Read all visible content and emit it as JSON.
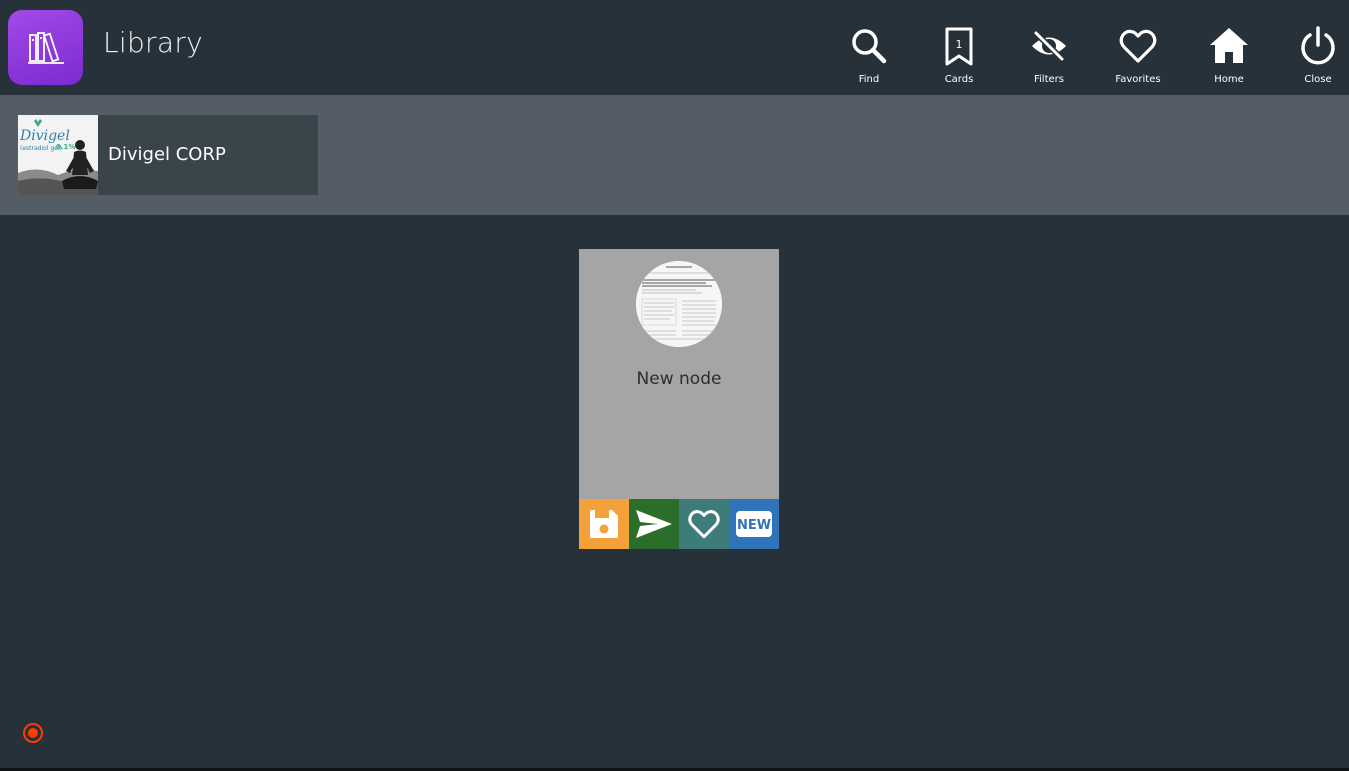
{
  "app": {
    "title": "Library",
    "logo_icon": "books-icon"
  },
  "toolbar": {
    "items": [
      {
        "label": "Find",
        "icon": "search-icon"
      },
      {
        "label": "Cards",
        "icon": "bookmark-icon",
        "badge": "1"
      },
      {
        "label": "Filters",
        "icon": "eye-off-icon"
      },
      {
        "label": "Favorites",
        "icon": "heart-icon"
      },
      {
        "label": "Home",
        "icon": "home-icon"
      },
      {
        "label": "Close",
        "icon": "power-icon"
      }
    ]
  },
  "collections": [
    {
      "name": "Divigel CORP",
      "thumb_text": {
        "brand": "Divigel",
        "subtitle": "(estradiol gel)",
        "percent": "0.1%"
      }
    }
  ],
  "card": {
    "title": "New node",
    "thumbnail_icon": "document-thumbnail",
    "actions": [
      {
        "icon": "save-icon",
        "color": "#f4a13b"
      },
      {
        "icon": "send-icon",
        "color": "#2b6e2a"
      },
      {
        "icon": "heart-icon",
        "color": "#3d7c78"
      },
      {
        "icon": "new-badge-icon",
        "label": "NEW",
        "color": "#2f73b8"
      }
    ]
  },
  "colors": {
    "background": "#273139",
    "strip": "#545d66",
    "accent_logo": "#8d36dc",
    "status": "#ff3b00"
  }
}
